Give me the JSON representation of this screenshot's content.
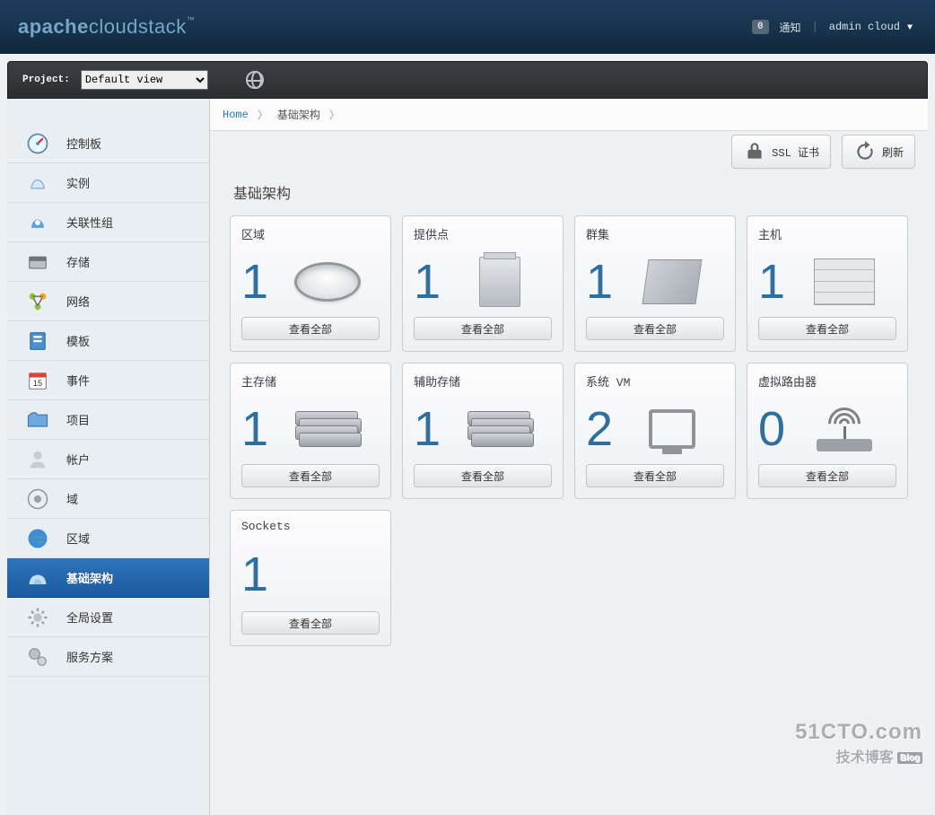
{
  "header": {
    "logo_bold": "apache",
    "logo_light": "cloudstack",
    "notif_count": "0",
    "notif_label": "通知",
    "user": "admin cloud"
  },
  "project_bar": {
    "label": "Project:",
    "selected": "Default view"
  },
  "sidebar": [
    {
      "key": "dashboard",
      "label": "控制板"
    },
    {
      "key": "instances",
      "label": "实例"
    },
    {
      "key": "affinity",
      "label": "关联性组"
    },
    {
      "key": "storage",
      "label": "存储"
    },
    {
      "key": "network",
      "label": "网络"
    },
    {
      "key": "templates",
      "label": "模板"
    },
    {
      "key": "events",
      "label": "事件"
    },
    {
      "key": "projects",
      "label": "项目"
    },
    {
      "key": "accounts",
      "label": "帐户"
    },
    {
      "key": "domains",
      "label": "域"
    },
    {
      "key": "regions",
      "label": "区域"
    },
    {
      "key": "infrastructure",
      "label": "基础架构",
      "active": true
    },
    {
      "key": "global",
      "label": "全局设置"
    },
    {
      "key": "service",
      "label": "服务方案"
    }
  ],
  "breadcrumb": {
    "home": "Home",
    "current": "基础架构"
  },
  "actions": {
    "ssl": "SSL 证书",
    "refresh": "刷新"
  },
  "page_title": "基础架构",
  "tiles": [
    {
      "key": "zones",
      "title": "区域",
      "count": "1",
      "button": "查看全部",
      "ill": "zone"
    },
    {
      "key": "pods",
      "title": "提供点",
      "count": "1",
      "button": "查看全部",
      "ill": "pod"
    },
    {
      "key": "clusters",
      "title": "群集",
      "count": "1",
      "button": "查看全部",
      "ill": "cluster"
    },
    {
      "key": "hosts",
      "title": "主机",
      "count": "1",
      "button": "查看全部",
      "ill": "host"
    },
    {
      "key": "primary",
      "title": "主存储",
      "count": "1",
      "button": "查看全部",
      "ill": "disks"
    },
    {
      "key": "secondary",
      "title": "辅助存储",
      "count": "1",
      "button": "查看全部",
      "ill": "disks"
    },
    {
      "key": "sysvm",
      "title": "系统 VM",
      "count": "2",
      "button": "查看全部",
      "ill": "vm"
    },
    {
      "key": "vrouter",
      "title": "虚拟路由器",
      "count": "0",
      "button": "查看全部",
      "ill": "router"
    },
    {
      "key": "sockets",
      "title": "Sockets",
      "count": "1",
      "button": "查看全部",
      "ill": "none"
    }
  ],
  "watermark": {
    "line1": "51CTO.com",
    "line2": "技术博客",
    "badge": "Blog"
  }
}
